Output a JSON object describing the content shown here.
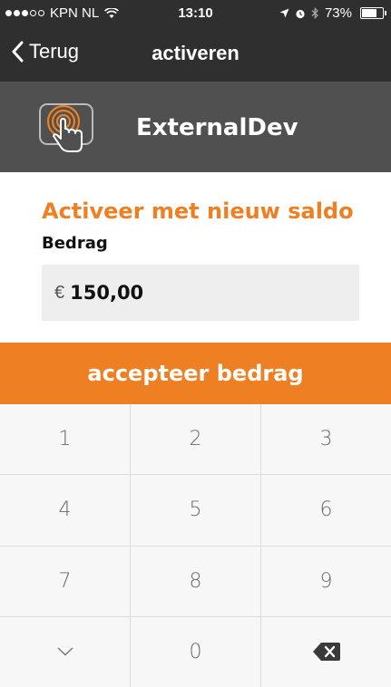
{
  "status_bar": {
    "carrier": "KPN NL",
    "time": "13:10",
    "battery": "73%",
    "battery_level": 0.73
  },
  "nav": {
    "back_label": "Terug",
    "title": "activeren"
  },
  "account": {
    "name": "ExternalDev",
    "icon": "touch-card-icon"
  },
  "form": {
    "section_title": "Activeer met nieuw saldo",
    "amount_label": "Bedrag",
    "currency": "€",
    "amount_value": "150,00"
  },
  "accept_button": {
    "label": "accepteer bedrag"
  },
  "keypad": {
    "keys": [
      "1",
      "2",
      "3",
      "4",
      "5",
      "6",
      "7",
      "8",
      "9",
      "",
      "0",
      ""
    ],
    "hide_icon": "chevron-down-icon",
    "delete_icon": "backspace-icon"
  },
  "colors": {
    "accent": "#ee7f22",
    "bar": "#2f2f2f",
    "header": "#505050"
  }
}
